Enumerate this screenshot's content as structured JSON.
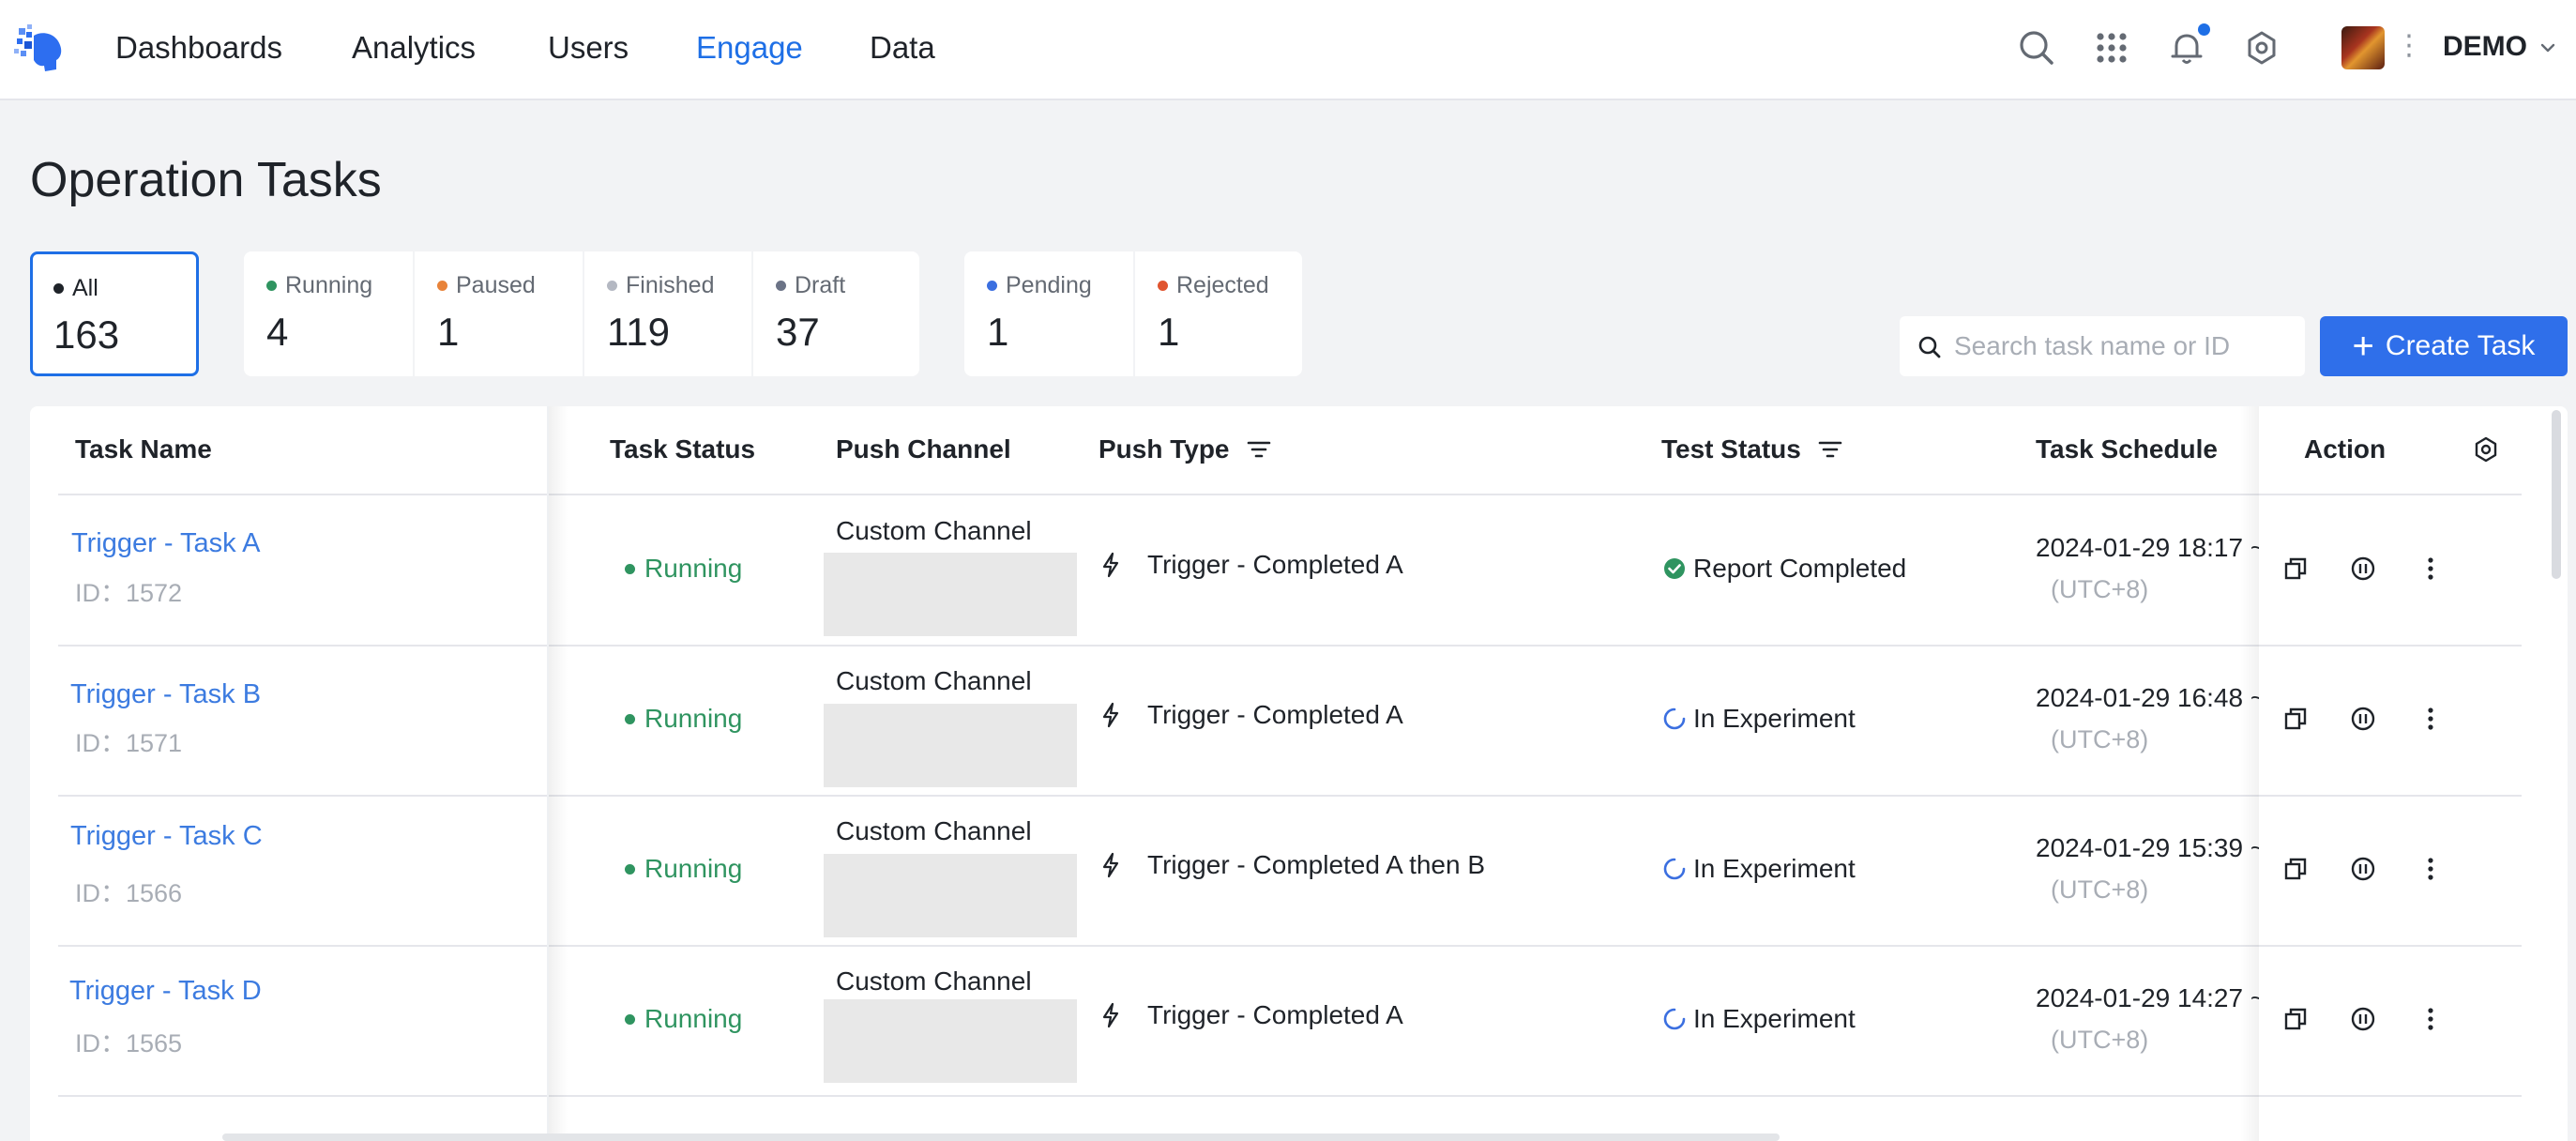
{
  "nav": {
    "items": [
      {
        "label": "Dashboards",
        "active": false
      },
      {
        "label": "Analytics",
        "active": false
      },
      {
        "label": "Users",
        "active": false
      },
      {
        "label": "Engage",
        "active": true
      },
      {
        "label": "Data",
        "active": false
      }
    ],
    "icons": [
      "search-icon",
      "apps-grid-icon",
      "bell-icon",
      "gear-icon"
    ],
    "org_name": "DEMO",
    "accent_color": "#1e6fe6"
  },
  "page": {
    "title": "Operation Tasks"
  },
  "stats": {
    "all": {
      "label": "All",
      "value": "163",
      "color": "#1f2329"
    },
    "running": {
      "label": "Running",
      "value": "4",
      "color": "#2f9460"
    },
    "paused": {
      "label": "Paused",
      "value": "1",
      "color": "#e8833a"
    },
    "finished": {
      "label": "Finished",
      "value": "119",
      "color": "#b4b8c2"
    },
    "draft": {
      "label": "Draft",
      "value": "37",
      "color": "#6b7386"
    },
    "pending": {
      "label": "Pending",
      "value": "1",
      "color": "#3b6fe0"
    },
    "rejected": {
      "label": "Rejected",
      "value": "1",
      "color": "#e0542f"
    }
  },
  "search": {
    "placeholder": "Search task name or ID",
    "value": ""
  },
  "create_button": {
    "label": "Create Task"
  },
  "table": {
    "columns": {
      "task_name": "Task Name",
      "task_status": "Task Status",
      "push_channel": "Push Channel",
      "push_type": "Push Type",
      "test_status": "Test Status",
      "task_schedule": "Task Schedule",
      "action": "Action"
    },
    "rows": [
      {
        "name": "Trigger - Task A",
        "id": "ID：1572",
        "status": "Running",
        "channel": "Custom Channel",
        "push_type": "Trigger - Completed A",
        "test_status": "Report Completed",
        "test_state": "completed",
        "schedule": "2024-01-29 18:17 ~",
        "timezone": "(UTC+8)"
      },
      {
        "name": "Trigger - Task B",
        "id": "ID：1571",
        "status": "Running",
        "channel": "Custom Channel",
        "push_type": "Trigger - Completed A",
        "test_status": "In Experiment",
        "test_state": "in-progress",
        "schedule": "2024-01-29 16:48 ~",
        "timezone": "(UTC+8)"
      },
      {
        "name": "Trigger - Task C",
        "id": "ID：1566",
        "status": "Running",
        "channel": "Custom Channel",
        "push_type": "Trigger - Completed A then B",
        "test_status": "In Experiment",
        "test_state": "in-progress",
        "schedule": "2024-01-29 15:39 ~",
        "timezone": "(UTC+8)"
      },
      {
        "name": "Trigger - Task D",
        "id": "ID：1565",
        "status": "Running",
        "channel": "Custom Channel",
        "push_type": "Trigger - Completed A",
        "test_status": "In Experiment",
        "test_state": "in-progress",
        "schedule": "2024-01-29 14:27 ~",
        "timezone": "(UTC+8)"
      }
    ],
    "row_actions": [
      "copy-icon",
      "pause-icon",
      "more-icon"
    ]
  }
}
